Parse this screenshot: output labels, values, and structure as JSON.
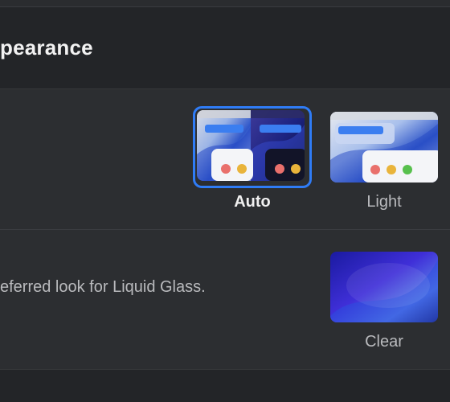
{
  "header": {
    "title": "pearance"
  },
  "appearance": {
    "options": [
      {
        "label": "Auto",
        "selected": true
      },
      {
        "label": "Light",
        "selected": false
      }
    ]
  },
  "liquid_glass": {
    "description": "eferred look for Liquid Glass.",
    "options": [
      {
        "label": "Clear",
        "selected": false
      }
    ]
  },
  "colors": {
    "accent": "#2f7cf6",
    "window_bg": "#232528",
    "panel_bg": "#2c2e31"
  }
}
